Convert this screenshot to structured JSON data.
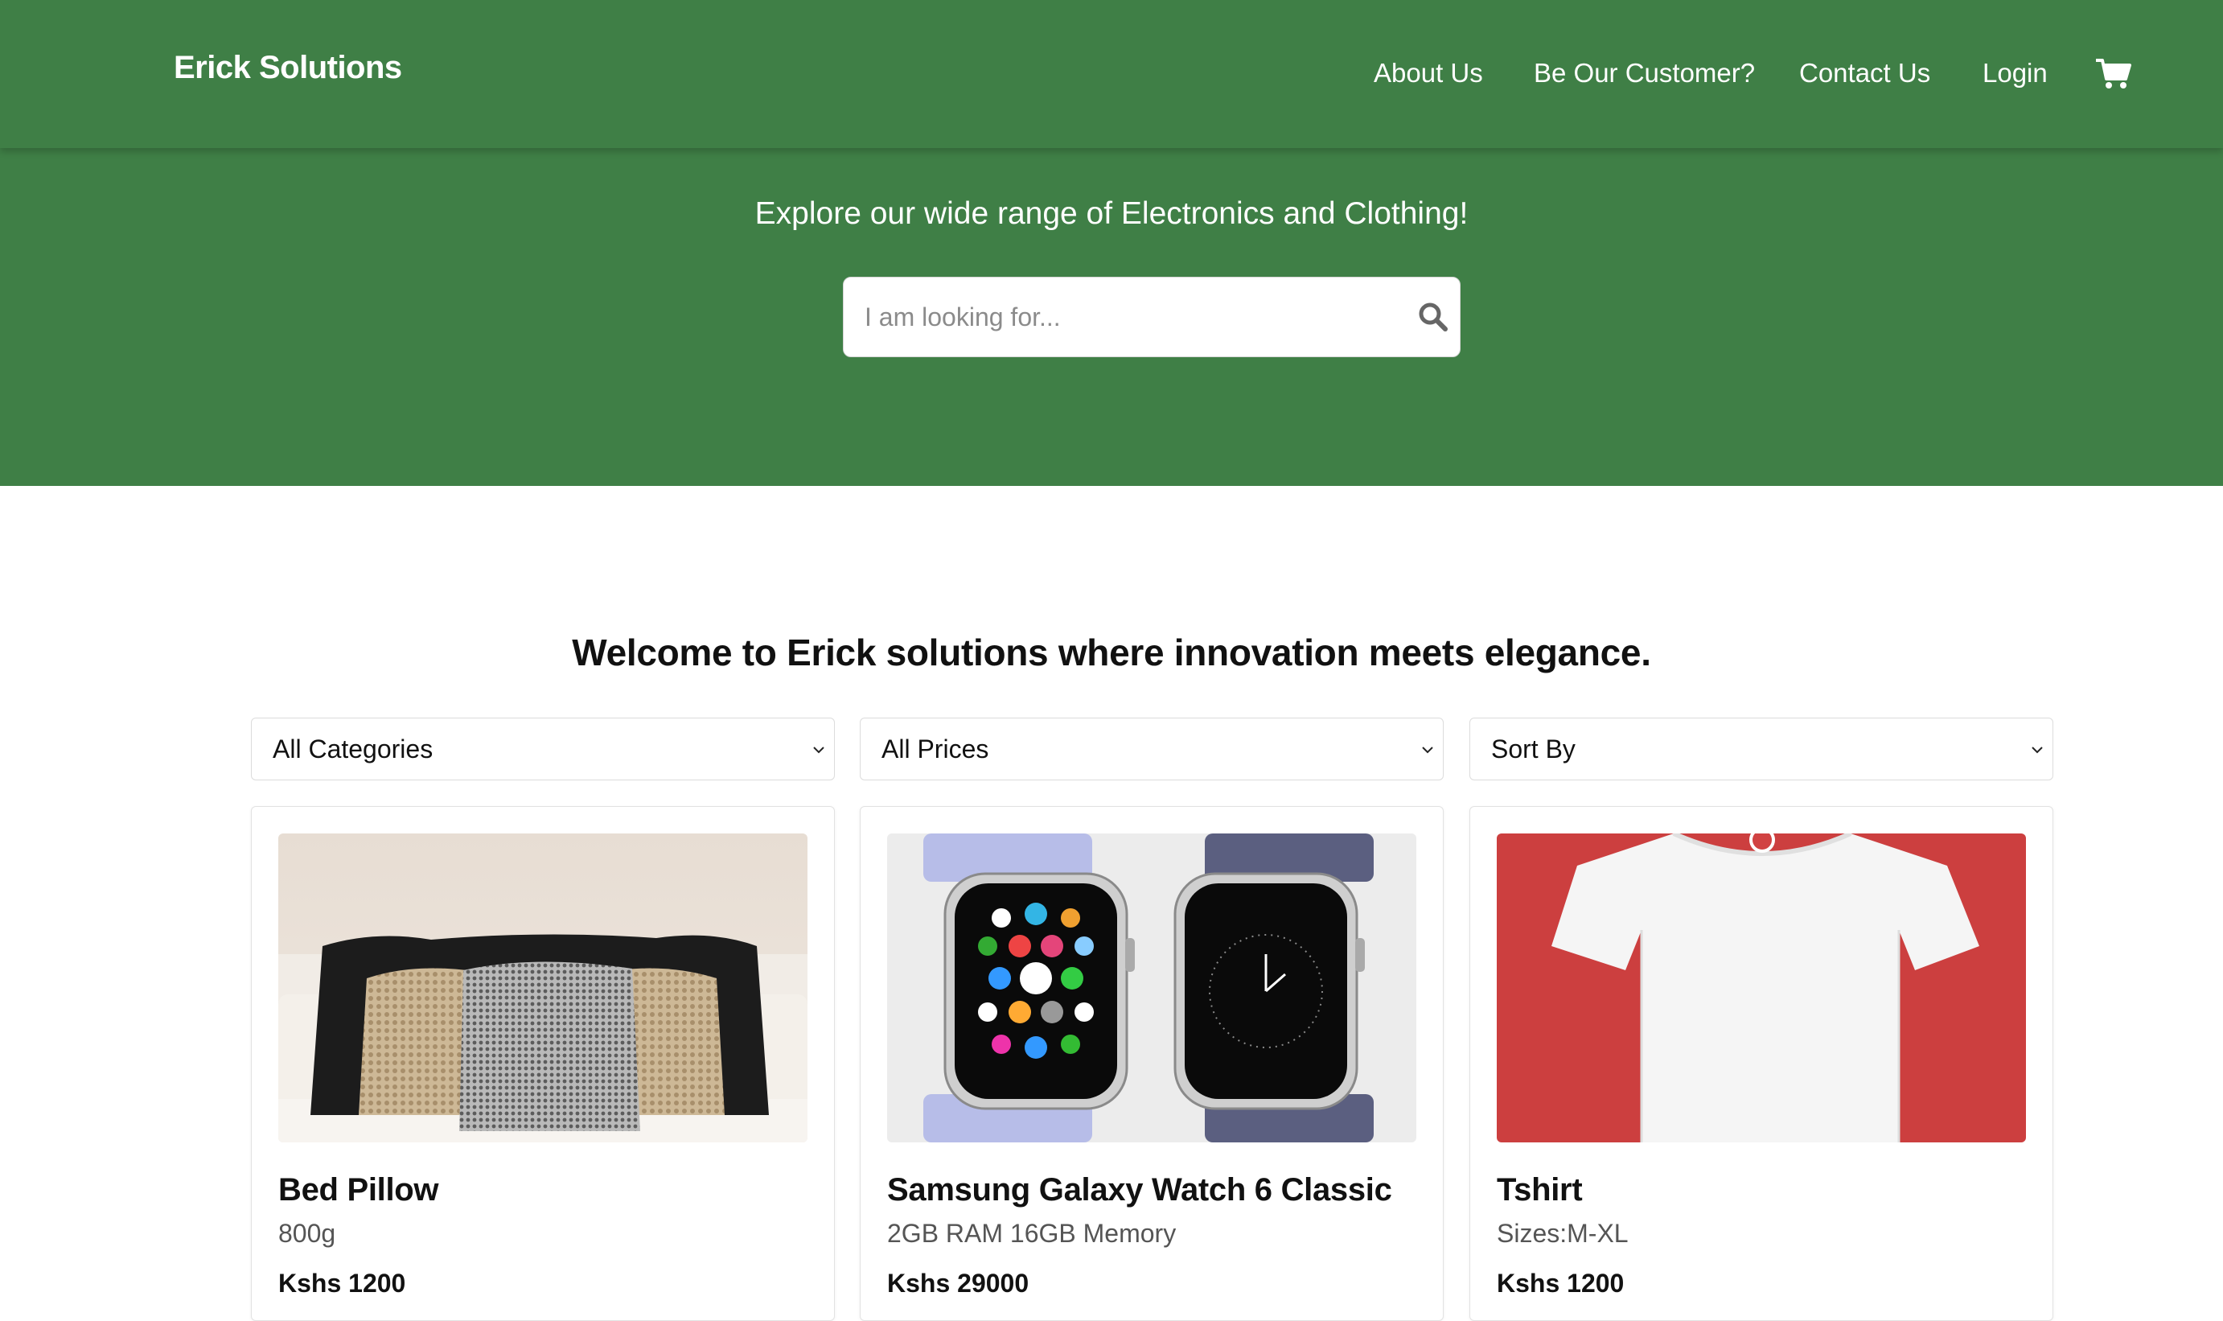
{
  "navbar": {
    "brand": "Erick Solutions",
    "links": [
      "About Us",
      "Be Our Customer?",
      "Contact Us",
      "Login"
    ],
    "cart_icon": "shopping-cart-icon",
    "background": "#3f7f46"
  },
  "hero": {
    "title": "Explore our wide range of Electronics and Clothing!",
    "search": {
      "placeholder": "I am looking for...",
      "value": "",
      "icon": "search-icon"
    }
  },
  "main": {
    "welcome": "Welcome to Erick solutions where innovation meets elegance.",
    "filters": [
      {
        "selected": "All Categories"
      },
      {
        "selected": "All Prices"
      },
      {
        "selected": "Sort By"
      }
    ],
    "products": [
      {
        "name": "Bed Pillow",
        "description": "800g",
        "price": "Kshs 1200",
        "image": "pillows-photo"
      },
      {
        "name": "Samsung Galaxy Watch 6 Classic",
        "description": "2GB RAM 16GB Memory",
        "price": "Kshs 29000",
        "image": "smartwatch-photo"
      },
      {
        "name": "Tshirt",
        "description": "Sizes:M-XL",
        "price": "Kshs 1200",
        "image": "tshirt-photo"
      }
    ]
  }
}
